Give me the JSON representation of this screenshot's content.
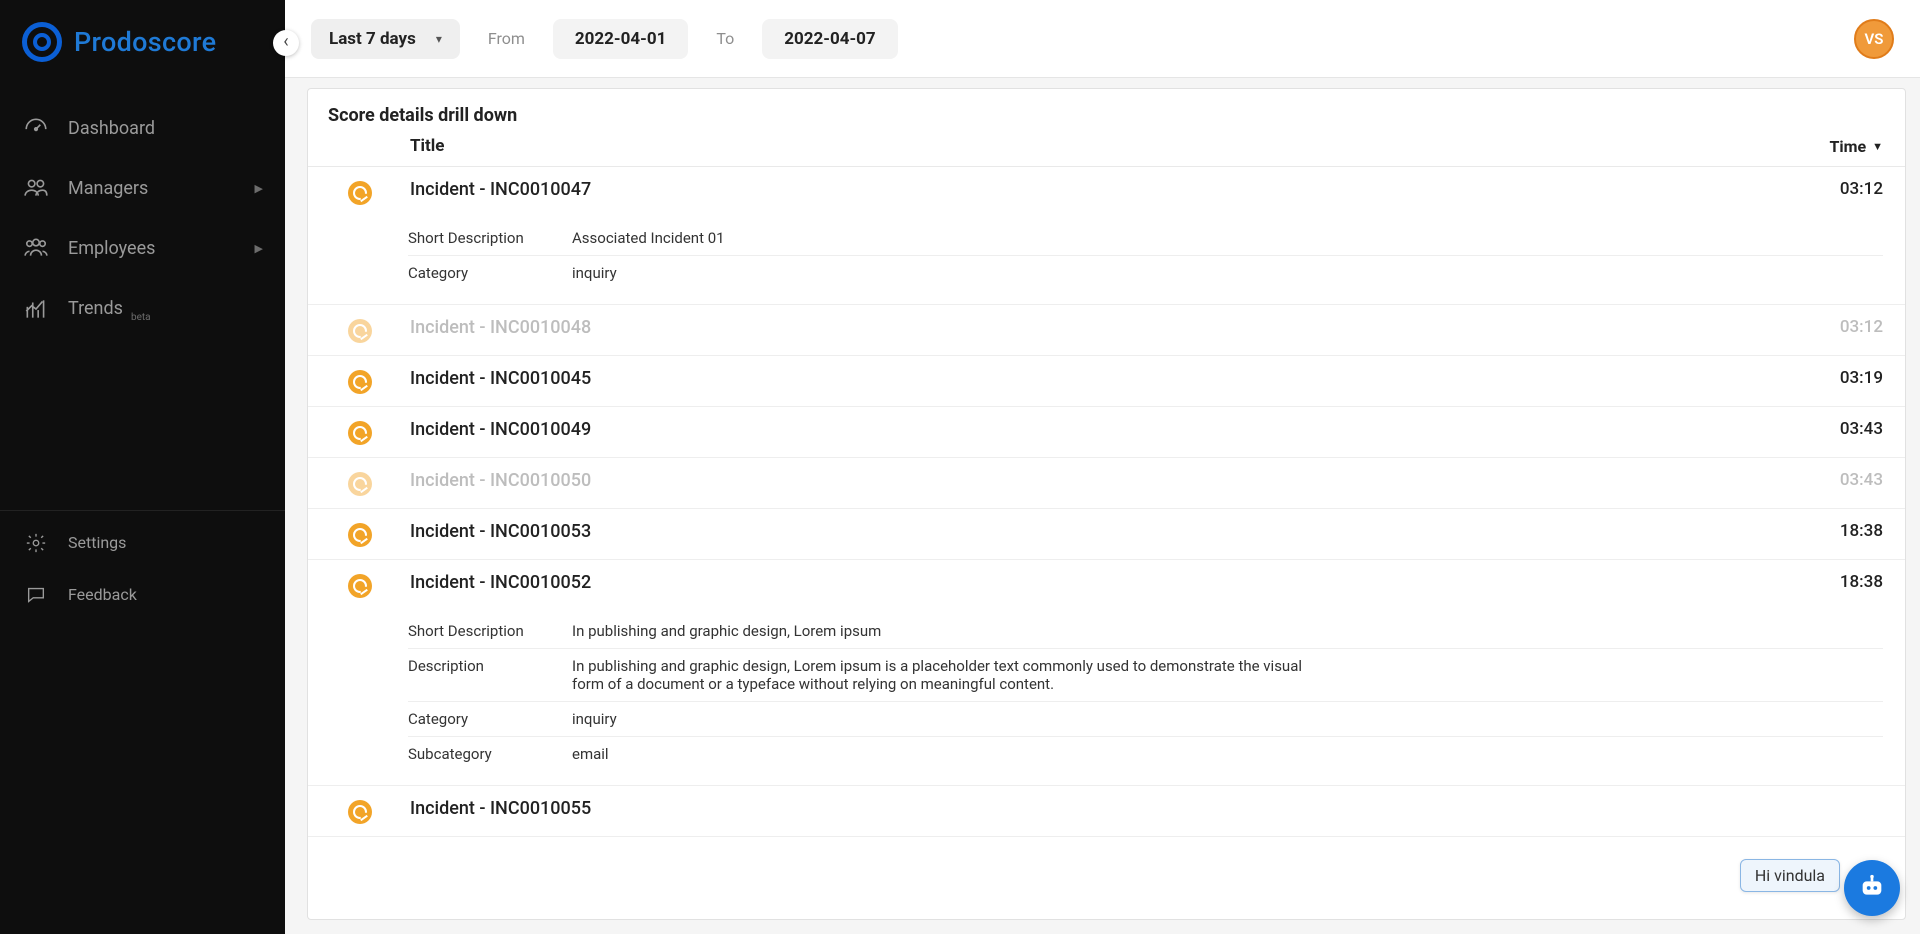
{
  "brand": {
    "name": "Prodoscore"
  },
  "sidebar": {
    "items": [
      {
        "label": "Dashboard",
        "icon": "dashboard"
      },
      {
        "label": "Managers",
        "icon": "managers",
        "has_children": true
      },
      {
        "label": "Employees",
        "icon": "employees",
        "has_children": true
      },
      {
        "label": "Trends",
        "icon": "trends",
        "badge": "beta"
      }
    ],
    "bottom": [
      {
        "label": "Settings",
        "icon": "settings"
      },
      {
        "label": "Feedback",
        "icon": "feedback"
      }
    ]
  },
  "topbar": {
    "range_label": "Last 7 days",
    "from_label": "From",
    "from_value": "2022-04-01",
    "to_label": "To",
    "to_value": "2022-04-07",
    "avatar_initials": "VS"
  },
  "card": {
    "title": "Score details drill down",
    "columns": {
      "title": "Title",
      "time": "Time"
    }
  },
  "detail_labels": {
    "short_description": "Short Description",
    "description": "Description",
    "category": "Category",
    "subcategory": "Subcategory"
  },
  "rows": [
    {
      "title": "Incident - INC0010047",
      "time": "03:12",
      "faded": false,
      "details": [
        {
          "label_key": "short_description",
          "value": "Associated Incident 01"
        },
        {
          "label_key": "category",
          "value": "inquiry"
        }
      ]
    },
    {
      "title": "Incident - INC0010048",
      "time": "03:12",
      "faded": true
    },
    {
      "title": "Incident - INC0010045",
      "time": "03:19",
      "faded": false
    },
    {
      "title": "Incident - INC0010049",
      "time": "03:43",
      "faded": false
    },
    {
      "title": "Incident - INC0010050",
      "time": "03:43",
      "faded": true
    },
    {
      "title": "Incident - INC0010053",
      "time": "18:38",
      "faded": false
    },
    {
      "title": "Incident - INC0010052",
      "time": "18:38",
      "faded": false,
      "details": [
        {
          "label_key": "short_description",
          "value": "In publishing and graphic design, Lorem ipsum"
        },
        {
          "label_key": "description",
          "value": "In publishing and graphic design, Lorem ipsum is a placeholder text commonly used to demonstrate the visual form of a document or a typeface without relying on meaningful content."
        },
        {
          "label_key": "category",
          "value": "inquiry"
        },
        {
          "label_key": "subcategory",
          "value": "email"
        }
      ]
    },
    {
      "title": "Incident - INC0010055",
      "time": "",
      "faded": false
    }
  ],
  "chat": {
    "greeting": "Hi vindula"
  }
}
